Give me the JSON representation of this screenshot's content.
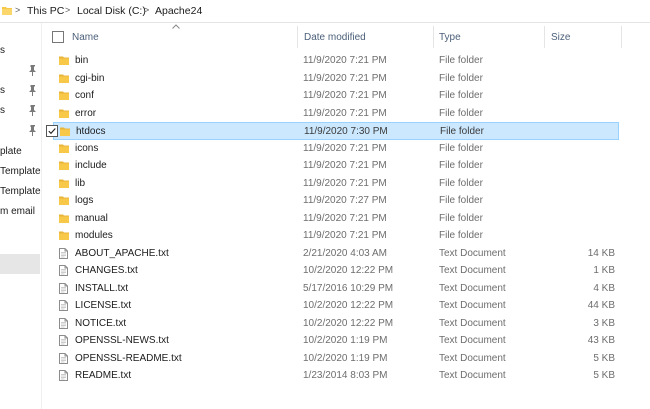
{
  "breadcrumb": {
    "items": [
      "This PC",
      "Local Disk (C:)",
      "Apache24"
    ],
    "separator": ">"
  },
  "nav": {
    "items": [
      {
        "label": "s",
        "pinned": false
      },
      {
        "label": "",
        "pinned": true
      },
      {
        "label": "s",
        "pinned": true
      },
      {
        "label": "s",
        "pinned": true
      },
      {
        "label": "",
        "pinned": true
      },
      {
        "label": "plate",
        "pinned": false
      },
      {
        "label": " Template",
        "pinned": false
      },
      {
        "label": " Template",
        "pinned": false
      },
      {
        "label": "m email",
        "pinned": false
      }
    ]
  },
  "columns": {
    "name": "Name",
    "date": "Date modified",
    "type": "Type",
    "size": "Size"
  },
  "files": [
    {
      "name": "bin",
      "date": "11/9/2020 7:21 PM",
      "type": "File folder",
      "size": "",
      "kind": "folder",
      "selected": false
    },
    {
      "name": "cgi-bin",
      "date": "11/9/2020 7:21 PM",
      "type": "File folder",
      "size": "",
      "kind": "folder",
      "selected": false
    },
    {
      "name": "conf",
      "date": "11/9/2020 7:21 PM",
      "type": "File folder",
      "size": "",
      "kind": "folder",
      "selected": false
    },
    {
      "name": "error",
      "date": "11/9/2020 7:21 PM",
      "type": "File folder",
      "size": "",
      "kind": "folder",
      "selected": false
    },
    {
      "name": "htdocs",
      "date": "11/9/2020 7:30 PM",
      "type": "File folder",
      "size": "",
      "kind": "folder",
      "selected": true
    },
    {
      "name": "icons",
      "date": "11/9/2020 7:21 PM",
      "type": "File folder",
      "size": "",
      "kind": "folder",
      "selected": false
    },
    {
      "name": "include",
      "date": "11/9/2020 7:21 PM",
      "type": "File folder",
      "size": "",
      "kind": "folder",
      "selected": false
    },
    {
      "name": "lib",
      "date": "11/9/2020 7:21 PM",
      "type": "File folder",
      "size": "",
      "kind": "folder",
      "selected": false
    },
    {
      "name": "logs",
      "date": "11/9/2020 7:27 PM",
      "type": "File folder",
      "size": "",
      "kind": "folder",
      "selected": false
    },
    {
      "name": "manual",
      "date": "11/9/2020 7:21 PM",
      "type": "File folder",
      "size": "",
      "kind": "folder",
      "selected": false
    },
    {
      "name": "modules",
      "date": "11/9/2020 7:21 PM",
      "type": "File folder",
      "size": "",
      "kind": "folder",
      "selected": false
    },
    {
      "name": "ABOUT_APACHE.txt",
      "date": "2/21/2020 4:03 AM",
      "type": "Text Document",
      "size": "14 KB",
      "kind": "text",
      "selected": false
    },
    {
      "name": "CHANGES.txt",
      "date": "10/2/2020 12:22 PM",
      "type": "Text Document",
      "size": "1 KB",
      "kind": "text",
      "selected": false
    },
    {
      "name": "INSTALL.txt",
      "date": "5/17/2016 10:29 PM",
      "type": "Text Document",
      "size": "4 KB",
      "kind": "text",
      "selected": false
    },
    {
      "name": "LICENSE.txt",
      "date": "10/2/2020 12:22 PM",
      "type": "Text Document",
      "size": "44 KB",
      "kind": "text",
      "selected": false
    },
    {
      "name": "NOTICE.txt",
      "date": "10/2/2020 12:22 PM",
      "type": "Text Document",
      "size": "3 KB",
      "kind": "text",
      "selected": false
    },
    {
      "name": "OPENSSL-NEWS.txt",
      "date": "10/2/2020 1:19 PM",
      "type": "Text Document",
      "size": "43 KB",
      "kind": "text",
      "selected": false
    },
    {
      "name": "OPENSSL-README.txt",
      "date": "10/2/2020 1:19 PM",
      "type": "Text Document",
      "size": "5 KB",
      "kind": "text",
      "selected": false
    },
    {
      "name": "README.txt",
      "date": "1/23/2014 8:03 PM",
      "type": "Text Document",
      "size": "5 KB",
      "kind": "text",
      "selected": false
    }
  ],
  "colors": {
    "selection_bg": "#cce8ff",
    "selection_border": "#99d1ff",
    "folder_yellow": "#f8c849",
    "header_text": "#4c607a"
  },
  "icons": {
    "folder": "folder-icon",
    "text": "text-file-icon",
    "pin": "pin-icon",
    "checkbox": "checkbox-icon",
    "sort": "sort-up-icon"
  }
}
